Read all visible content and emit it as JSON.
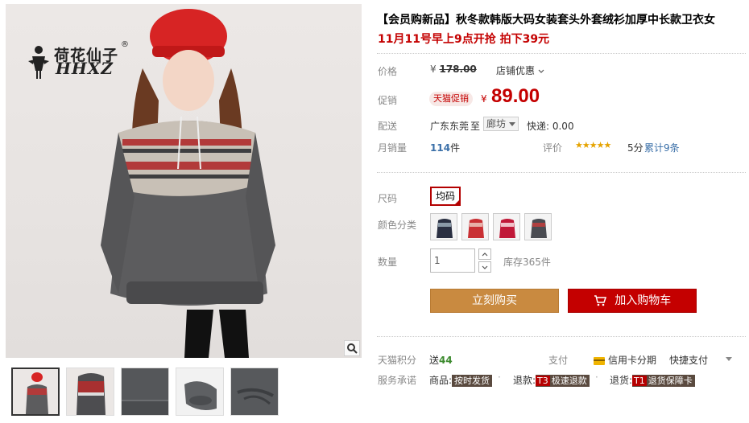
{
  "product": {
    "title": "【会员购新品】秋冬款韩版大码女装套头外套绒衫加厚中长款卫衣女",
    "subtitle": "11月11号早上9点开抢 拍下39元"
  },
  "brand": {
    "name_cn": "荷花仙子",
    "name_en": "HHXZ",
    "reg": "®"
  },
  "price": {
    "label": "价格",
    "currency": "¥",
    "original": "178.00",
    "store_promo": "店铺优惠"
  },
  "promo": {
    "label": "促销",
    "badge": "天猫促销",
    "currency": "¥",
    "price": "89.00"
  },
  "shipping": {
    "label": "配送",
    "from": "广东东莞",
    "to_word": "至",
    "destination": "廊坊",
    "fee": "快递: 0.00"
  },
  "sales": {
    "label": "月销量",
    "count": "114",
    "unit": "件",
    "rating_label": "评价",
    "stars": "★★★★★",
    "score": "5分",
    "reviews": "累计9条"
  },
  "size": {
    "label": "尺码",
    "selected": "均码"
  },
  "color": {
    "label": "颜色分类"
  },
  "quantity": {
    "label": "数量",
    "value": "1",
    "stock": "库存365件"
  },
  "actions": {
    "buy": "立刻购买",
    "cart": "加入购物车"
  },
  "extra": {
    "points_label": "天猫积分",
    "points_prefix": "送",
    "points_value": "44",
    "pay_label": "支付",
    "credit_pay": "信用卡分期",
    "quick_pay": "快捷支付"
  },
  "service": {
    "label": "服务承诺",
    "items": [
      {
        "prefix": "商品:",
        "code": "",
        "tag": "按时发货"
      },
      {
        "prefix": "退款:",
        "code": "T3",
        "tag": "极速退款"
      },
      {
        "prefix": "退货:",
        "code": "T1",
        "tag": "退货保障卡"
      }
    ]
  },
  "colors": {
    "promo_red": "#c40000",
    "buy_orange": "#c98a40",
    "link_blue": "#3a6fa8"
  }
}
